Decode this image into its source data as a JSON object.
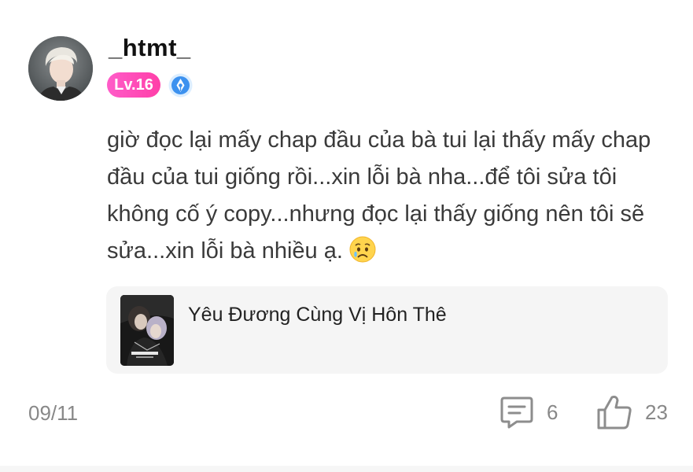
{
  "user": {
    "name": "_htmt_",
    "level": "Lv.16"
  },
  "comment": {
    "text": "giờ đọc lại mấy chap đầu của bà tui lại thấy mấy chap đầu của tui giống rồi...xin lỗi bà nha...để tôi sửa tôi không cố ý copy...nhưng đọc lại thấy giống nên tôi sẽ sửa...xin lỗi bà nhiều ạ."
  },
  "book": {
    "title": "Yêu Đương Cùng Vị Hôn Thê"
  },
  "footer": {
    "date": "09/11",
    "comment_count": "6",
    "like_count": "23"
  },
  "colors": {
    "level_badge": "#ff4fb8",
    "verify_badge": "#2f8cf0",
    "card_bg": "#f5f5f5",
    "muted_text": "#888888"
  }
}
